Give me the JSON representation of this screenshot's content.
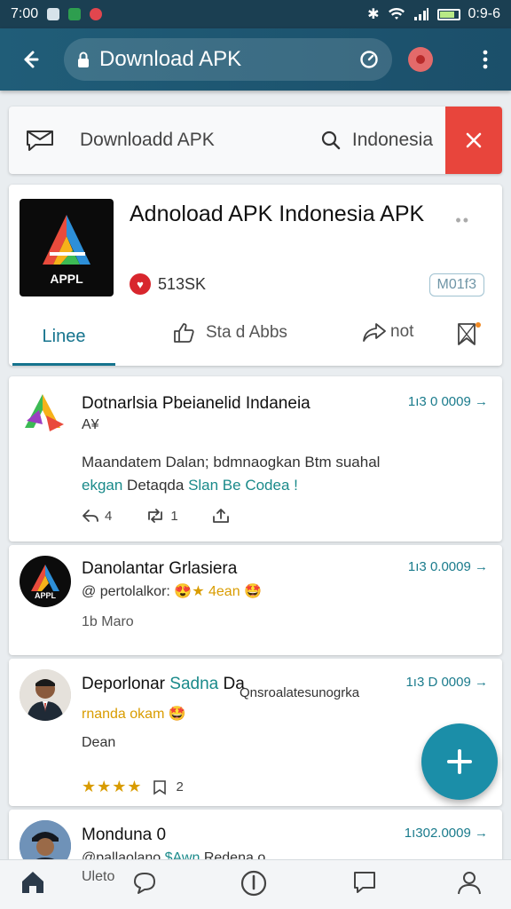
{
  "status_bar": {
    "time": "7:00",
    "clock_right": "0:9-6"
  },
  "app_bar": {
    "url": "Download APK"
  },
  "search_bar": {
    "label": "Downloadd APK",
    "query": "Indonesia"
  },
  "app_card": {
    "title": "Adnoload APK Indonesia APK",
    "logo_text": "APPL",
    "rating_count": "513SK",
    "install_tag": "M01f3",
    "tabs": {
      "live": "Linee",
      "like": "Sta d Abbs",
      "share": "not"
    }
  },
  "posts": [
    {
      "author": "Dotnarlsia Pbeianelid Indaneia",
      "time": "1ı3 0 0009 →",
      "badge": "A¥",
      "body_line1": "Maandatem Dalan; bdmnaogkan Btm suahal",
      "body_line2_teal": "ekgan",
      "body_line2": " Detaqda ",
      "body_line2_teal2": "Slan Be Codea !",
      "reply_count": "4",
      "retweet_count": "1"
    },
    {
      "author": "Danolantar Grlasiera",
      "time": "1ı3 0.0009 →",
      "handle": "@ pertolalkor: ",
      "handle_emoji": "😍★ 4ean 🤩",
      "meta": "1b Maro",
      "avatar_text": "APPL"
    },
    {
      "author": "Deporlonar ",
      "author_teal": "Sadna",
      "author_tail": " Da",
      "overlay": "Qnsroalatesunogrka",
      "time": "1ı3 D 0009 →",
      "line1_gold": "rnanda okam",
      "line1_emoji": "🤩",
      "line2": "Dean",
      "stars": "★★★★",
      "count": "2"
    },
    {
      "author": "Monduna 0",
      "time": "1ı302.0009 →",
      "handle": "@pallaolano ",
      "handle_teal": "$Awn",
      "handle_tail": " Redena o"
    }
  ],
  "bottom_nav": {
    "label": "Uleto"
  },
  "colors": {
    "app_bar": "#205d78",
    "accent": "#16748e",
    "close": "#e8453c",
    "fab": "#1b8ea8"
  }
}
